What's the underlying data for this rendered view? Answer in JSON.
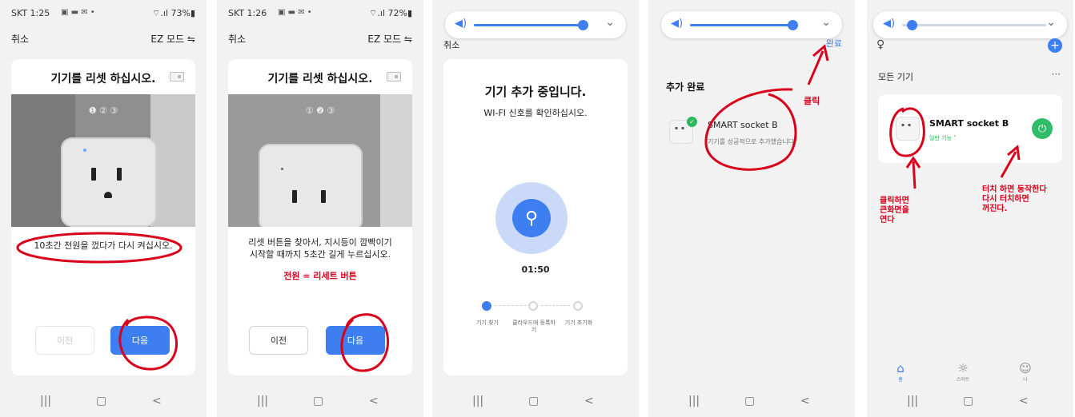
{
  "phone1": {
    "status": {
      "time": "SKT 1:25",
      "icons": "▣ ▬ ✉ •",
      "battery": "⌔.ıl 73%▮"
    },
    "topbar": {
      "cancel": "취소",
      "ez_mode": "EZ 모드 ⇋"
    },
    "title": "기기를 리셋 하십시오.",
    "steps": "❶ ② ③",
    "instruction": "10초간 전원을 껐다가 다시 켜십시오.",
    "prev_label": "이전",
    "next_label": "다음"
  },
  "phone2": {
    "status": {
      "time": "SKT 1:26",
      "icons": "▣ ▬ ✉ •",
      "battery": "⌔.ıl 72%▮"
    },
    "topbar": {
      "cancel": "취소",
      "ez_mode": "EZ 모드 ⇋"
    },
    "title": "기기를 리셋 하십시오.",
    "steps": "① ❷ ③",
    "instruction_1": "리셋 버튼을 찾아서, 지시등이 깜빡이기",
    "instruction_2": "시작할 때까지 5초간 길게 누르십시오.",
    "annotation": "전원 = 리세트 버튼",
    "prev_label": "이전",
    "next_label": "다음"
  },
  "phone3": {
    "volume_icon": "◀)",
    "cancel": "취소",
    "title": "기기 추가 중입니다.",
    "subtitle": "WI-FI 신호를 확인하십시오.",
    "search_icon": "⚲",
    "timer": "01:50",
    "steps": [
      "기기 찾기",
      "클라우드에 등록하기",
      "기기 초기화"
    ]
  },
  "phone4": {
    "volume_icon": "◀)",
    "done": "완료",
    "annotation_click": "클릭",
    "section_title": "추가 완료",
    "device_name": "SMART socket B",
    "device_status": "기기를 성공적으로 추가했습니다."
  },
  "phone5": {
    "volume_icon": "◀)",
    "person_icon": "♀",
    "add_icon": "+",
    "section_title": "모든 기기",
    "more": "···",
    "device_name": "SMART socket B",
    "device_sub": "일반 기능 ˅",
    "power_icon": "⏻",
    "annotation_left_1": "클릭하면",
    "annotation_left_2": "큰화면을",
    "annotation_left_3": "연다",
    "annotation_right_1": "터치 하면 동작한다",
    "annotation_right_2": "다시 터치하면",
    "annotation_right_3": "꺼진다.",
    "tabs": [
      {
        "icon": "⌂",
        "label": "홈"
      },
      {
        "icon": "☼",
        "label": "스마트"
      },
      {
        "icon": "☺",
        "label": "나"
      }
    ]
  },
  "nav": {
    "recent": "|||",
    "home": "▢",
    "back": "<"
  },
  "colors": {
    "accent": "#3d7ff0",
    "annotation": "#d8001a",
    "success": "#2cb85c"
  }
}
